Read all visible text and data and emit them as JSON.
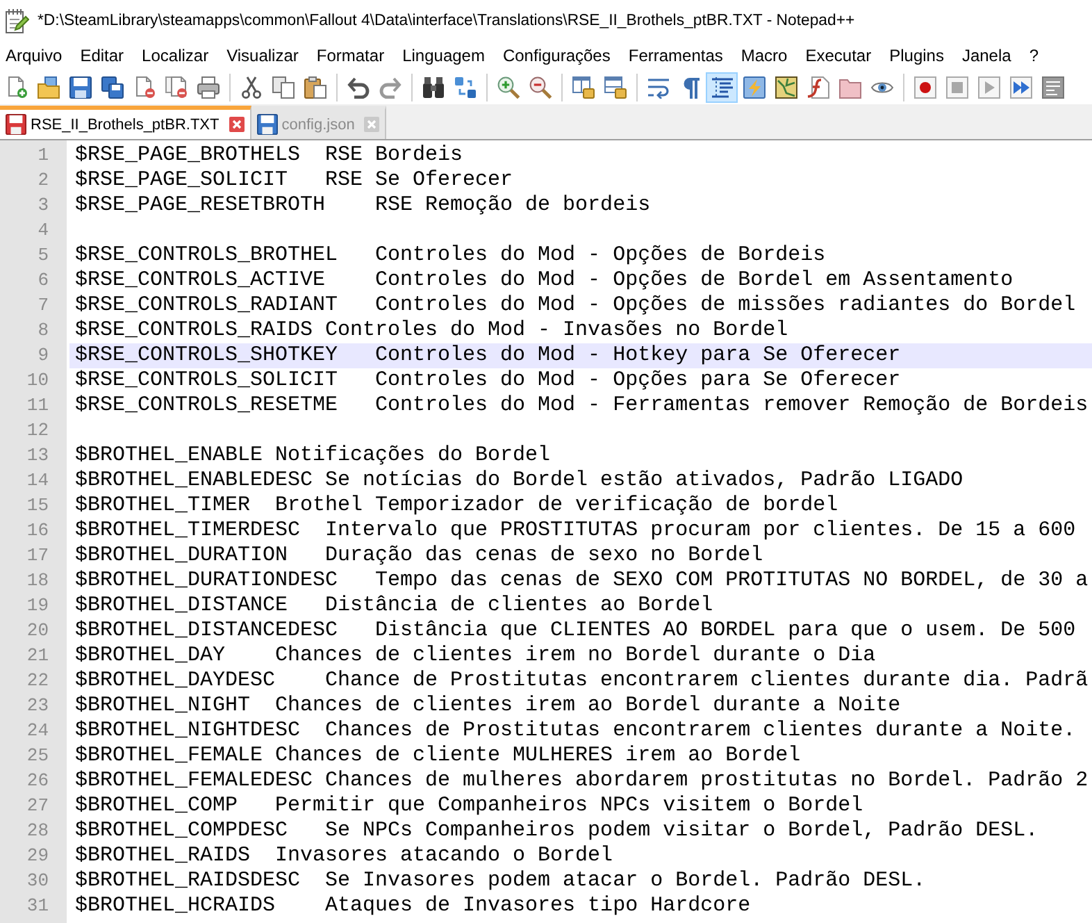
{
  "window": {
    "title": "*D:\\SteamLibrary\\steamapps\\common\\Fallout 4\\Data\\interface\\Translations\\RSE_II_Brothels_ptBR.TXT - Notepad++"
  },
  "menu": [
    "Arquivo",
    "Editar",
    "Localizar",
    "Visualizar",
    "Formatar",
    "Linguagem",
    "Configurações",
    "Ferramentas",
    "Macro",
    "Executar",
    "Plugins",
    "Janela",
    "?"
  ],
  "toolbar": {
    "groups": [
      {
        "buttons": [
          {
            "kind": "new",
            "pressed": false
          },
          {
            "kind": "open",
            "pressed": false
          },
          {
            "kind": "save",
            "pressed": false
          },
          {
            "kind": "saveall",
            "pressed": false
          },
          {
            "kind": "close",
            "pressed": false
          },
          {
            "kind": "closeall",
            "pressed": false
          },
          {
            "kind": "print",
            "pressed": false
          }
        ]
      },
      {
        "buttons": [
          {
            "kind": "cut",
            "pressed": false
          },
          {
            "kind": "copy",
            "pressed": false
          },
          {
            "kind": "paste",
            "pressed": false
          }
        ]
      },
      {
        "buttons": [
          {
            "kind": "undo",
            "pressed": false
          },
          {
            "kind": "redo",
            "pressed": false
          }
        ]
      },
      {
        "buttons": [
          {
            "kind": "find",
            "pressed": false
          },
          {
            "kind": "replace",
            "pressed": false
          }
        ]
      },
      {
        "buttons": [
          {
            "kind": "zoomin",
            "pressed": false
          },
          {
            "kind": "zoomout",
            "pressed": false
          }
        ]
      },
      {
        "buttons": [
          {
            "kind": "syncv",
            "pressed": false
          },
          {
            "kind": "synch",
            "pressed": false
          }
        ]
      },
      {
        "buttons": [
          {
            "kind": "wrap",
            "pressed": false
          },
          {
            "kind": "allchars",
            "pressed": false
          },
          {
            "kind": "indentguide",
            "pressed": true
          },
          {
            "kind": "userlang",
            "pressed": false
          },
          {
            "kind": "docmap",
            "pressed": false
          },
          {
            "kind": "funclist",
            "pressed": false
          },
          {
            "kind": "workspace",
            "pressed": false
          },
          {
            "kind": "monitor",
            "pressed": false
          }
        ]
      },
      {
        "buttons": [
          {
            "kind": "record",
            "pressed": false
          },
          {
            "kind": "stop",
            "pressed": false
          },
          {
            "kind": "play",
            "pressed": false
          },
          {
            "kind": "playmulti",
            "pressed": false
          },
          {
            "kind": "savemacro",
            "pressed": false
          }
        ]
      }
    ]
  },
  "tabs": [
    {
      "label": "RSE_II_Brothels_ptBR.TXT",
      "selected": true,
      "modified": true
    },
    {
      "label": "config.json",
      "selected": false,
      "modified": false
    }
  ],
  "editor": {
    "lines": [
      {
        "number": "1",
        "text": "$RSE_PAGE_BROTHELS  RSE Bordeis",
        "current": false
      },
      {
        "number": "2",
        "text": "$RSE_PAGE_SOLICIT   RSE Se Oferecer",
        "current": false
      },
      {
        "number": "3",
        "text": "$RSE_PAGE_RESETBROTH    RSE Remoção de bordeis",
        "current": false
      },
      {
        "number": "4",
        "current": false
      },
      {
        "number": "5",
        "text": "$RSE_CONTROLS_BROTHEL   Controles do Mod - Opções de Bordeis",
        "current": false
      },
      {
        "number": "6",
        "text": "$RSE_CONTROLS_ACTIVE    Controles do Mod - Opções de Bordel em Assentamento",
        "current": false
      },
      {
        "number": "7",
        "text": "$RSE_CONTROLS_RADIANT   Controles do Mod - Opções de missões radiantes do Bordel",
        "current": false
      },
      {
        "number": "8",
        "text": "$RSE_CONTROLS_RAIDS Controles do Mod - Invasões no Bordel",
        "current": false
      },
      {
        "number": "9",
        "text": "$RSE_CONTROLS_SHOTKEY   Controles do Mod - Hotkey para Se Oferecer",
        "current": true
      },
      {
        "number": "10",
        "text": "$RSE_CONTROLS_SOLICIT   Controles do Mod - Opções para Se Oferecer",
        "current": false
      },
      {
        "number": "11",
        "text": "$RSE_CONTROLS_RESETME   Controles do Mod - Ferramentas remover Remoção de Bordeis",
        "current": false
      },
      {
        "number": "12",
        "current": false
      },
      {
        "number": "13",
        "text": "$BROTHEL_ENABLE Notificações do Bordel",
        "current": false
      },
      {
        "number": "14",
        "text": "$BROTHEL_ENABLEDESC Se notícias do Bordel estão ativados, Padrão LIGADO",
        "current": false
      },
      {
        "number": "15",
        "text": "$BROTHEL_TIMER  Brothel Temporizador de verificação de bordel",
        "current": false
      },
      {
        "number": "16",
        "text": "$BROTHEL_TIMERDESC  Intervalo que PROSTITUTAS procuram por clientes. De 15 a 600",
        "current": false
      },
      {
        "number": "17",
        "text": "$BROTHEL_DURATION   Duração das cenas de sexo no Bordel",
        "current": false
      },
      {
        "number": "18",
        "text": "$BROTHEL_DURATIONDESC   Tempo das cenas de SEXO COM PROTITUTAS NO BORDEL, de 30 a",
        "current": false
      },
      {
        "number": "19",
        "text": "$BROTHEL_DISTANCE   Distância de clientes ao Bordel",
        "current": false
      },
      {
        "number": "20",
        "text": "$BROTHEL_DISTANCEDESC   Distância que CLIENTES AO BORDEL para que o usem. De 500",
        "current": false
      },
      {
        "number": "21",
        "text": "$BROTHEL_DAY    Chances de clientes irem no Bordel durante o Dia",
        "current": false
      },
      {
        "number": "22",
        "text": "$BROTHEL_DAYDESC    Chance de Prostitutas encontrarem clientes durante dia. Padrã",
        "current": false
      },
      {
        "number": "23",
        "text": "$BROTHEL_NIGHT  Chances de clientes irem ao Bordel durante a Noite",
        "current": false
      },
      {
        "number": "24",
        "text": "$BROTHEL_NIGHTDESC  Chances de Prostitutas encontrarem clientes durante a Noite.",
        "current": false
      },
      {
        "number": "25",
        "text": "$BROTHEL_FEMALE Chances de cliente MULHERES irem ao Bordel",
        "current": false
      },
      {
        "number": "26",
        "text": "$BROTHEL_FEMALEDESC Chances de mulheres abordarem prostitutas no Bordel. Padrão 2",
        "current": false
      },
      {
        "number": "27",
        "text": "$BROTHEL_COMP   Permitir que Companheiros NPCs visitem o Bordel",
        "current": false
      },
      {
        "number": "28",
        "text": "$BROTHEL_COMPDESC   Se NPCs Companheiros podem visitar o Bordel, Padrão DESL.",
        "current": false
      },
      {
        "number": "29",
        "text": "$BROTHEL_RAIDS  Invasores atacando o Bordel",
        "current": false
      },
      {
        "number": "30",
        "text": "$BROTHEL_RAIDSDESC  Se Invasores podem atacar o Bordel. Padrão DESL.",
        "current": false
      },
      {
        "number": "31",
        "text": "$BROTHEL_HCRAIDS    Ataques de Invasores tipo Hardcore",
        "current": false
      }
    ]
  }
}
